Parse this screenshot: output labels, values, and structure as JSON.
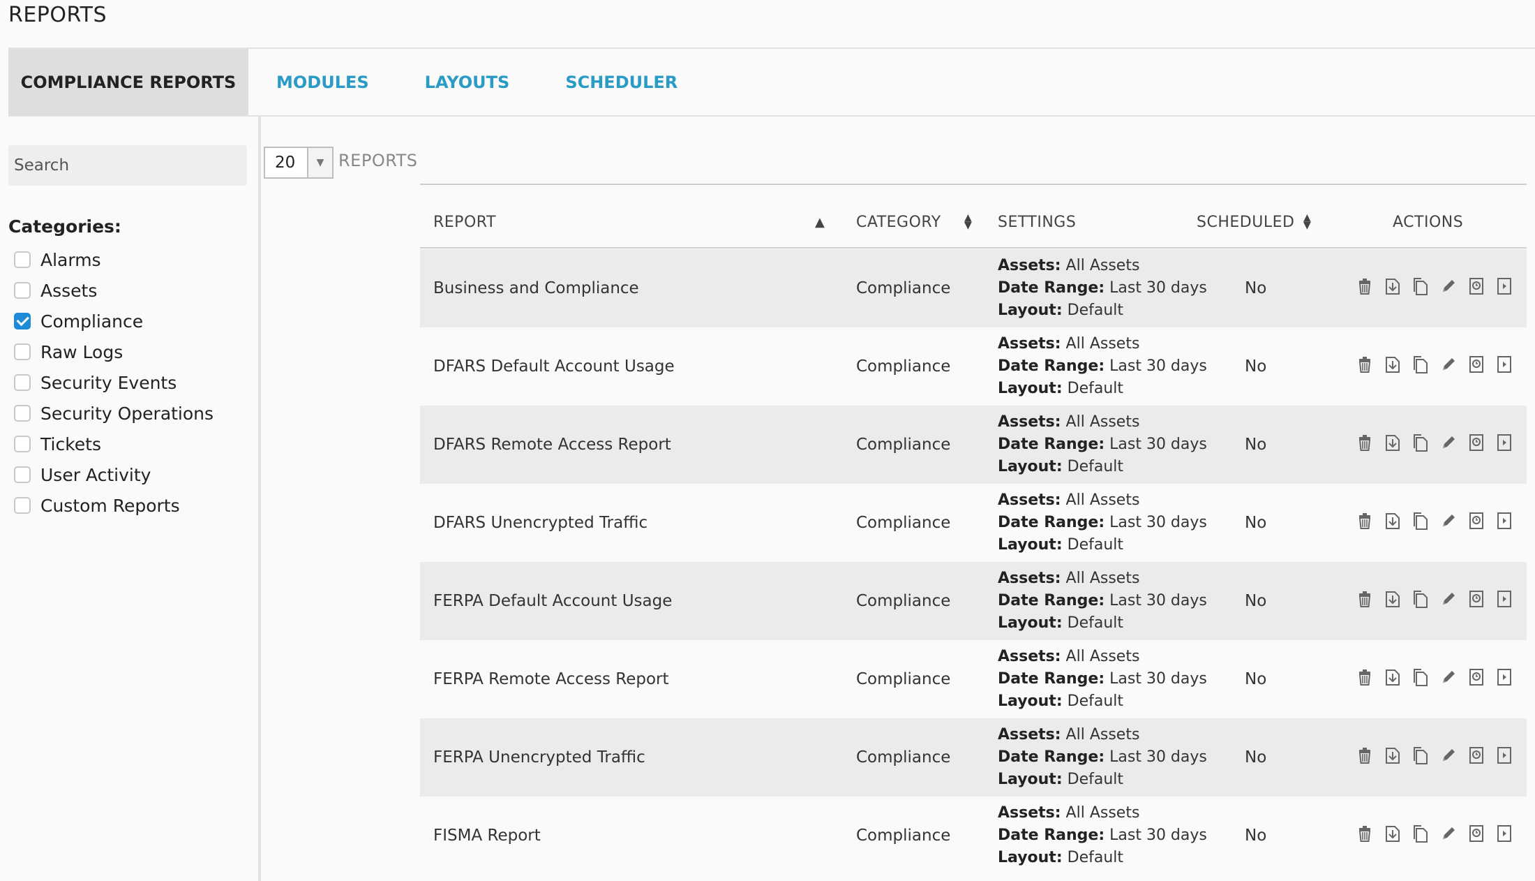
{
  "page": {
    "title": "REPORTS"
  },
  "tabs": [
    {
      "label": "COMPLIANCE REPORTS",
      "active": true
    },
    {
      "label": "MODULES",
      "active": false
    },
    {
      "label": "LAYOUTS",
      "active": false
    },
    {
      "label": "SCHEDULER",
      "active": false
    }
  ],
  "sidebar": {
    "search_placeholder": "Search",
    "categories_title": "Categories:",
    "categories": [
      {
        "label": "Alarms",
        "checked": false
      },
      {
        "label": "Assets",
        "checked": false
      },
      {
        "label": "Compliance",
        "checked": true
      },
      {
        "label": "Raw Logs",
        "checked": false
      },
      {
        "label": "Security Events",
        "checked": false
      },
      {
        "label": "Security Operations",
        "checked": false
      },
      {
        "label": "Tickets",
        "checked": false
      },
      {
        "label": "User Activity",
        "checked": false
      },
      {
        "label": "Custom Reports",
        "checked": false
      }
    ]
  },
  "toolbar": {
    "page_size": "20",
    "reports_label": "REPORTS"
  },
  "table": {
    "headers": {
      "report": "REPORT",
      "category": "CATEGORY",
      "settings": "SETTINGS",
      "scheduled": "SCHEDULED",
      "actions": "ACTIONS"
    },
    "settings_labels": {
      "assets": "Assets:",
      "date_range": "Date Range:",
      "layout": "Layout:"
    },
    "rows": [
      {
        "report": "Business and Compliance",
        "category": "Compliance",
        "assets": "All Assets",
        "date_range": "Last 30 days",
        "layout": "Default",
        "scheduled": "No"
      },
      {
        "report": "DFARS Default Account Usage",
        "category": "Compliance",
        "assets": "All Assets",
        "date_range": "Last 30 days",
        "layout": "Default",
        "scheduled": "No"
      },
      {
        "report": "DFARS Remote Access Report",
        "category": "Compliance",
        "assets": "All Assets",
        "date_range": "Last 30 days",
        "layout": "Default",
        "scheduled": "No"
      },
      {
        "report": "DFARS Unencrypted Traffic",
        "category": "Compliance",
        "assets": "All Assets",
        "date_range": "Last 30 days",
        "layout": "Default",
        "scheduled": "No"
      },
      {
        "report": "FERPA Default Account Usage",
        "category": "Compliance",
        "assets": "All Assets",
        "date_range": "Last 30 days",
        "layout": "Default",
        "scheduled": "No"
      },
      {
        "report": "FERPA Remote Access Report",
        "category": "Compliance",
        "assets": "All Assets",
        "date_range": "Last 30 days",
        "layout": "Default",
        "scheduled": "No"
      },
      {
        "report": "FERPA Unencrypted Traffic",
        "category": "Compliance",
        "assets": "All Assets",
        "date_range": "Last 30 days",
        "layout": "Default",
        "scheduled": "No"
      },
      {
        "report": "FISMA Report",
        "category": "Compliance",
        "assets": "All Assets",
        "date_range": "Last 30 days",
        "layout": "Default",
        "scheduled": "No"
      }
    ],
    "action_icons": [
      "trash-icon",
      "download-icon",
      "copy-icon",
      "edit-pencil-icon",
      "schedule-clock-icon",
      "run-play-icon"
    ]
  }
}
